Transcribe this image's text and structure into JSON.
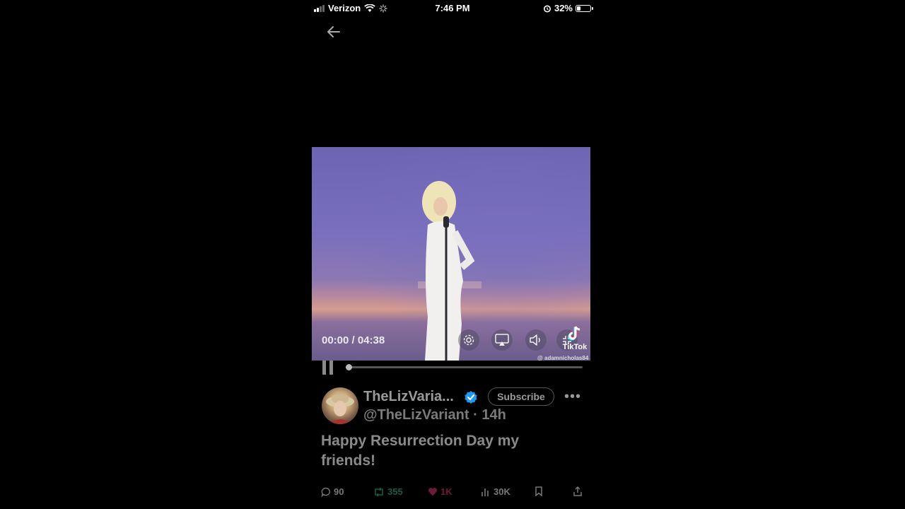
{
  "status_bar": {
    "carrier": "Verizon",
    "time": "7:46 PM",
    "battery": "32%",
    "battery_level": 0.32,
    "signal_bars": 2
  },
  "video": {
    "time_display": "00:00 / 04:38",
    "watermark_brand": "TikTok",
    "watermark_handle": "@ adamnicholas84",
    "progress": 0.0
  },
  "tweet": {
    "display_name": "TheLizVaria...",
    "handle": "@TheLizVariant",
    "separator": "·",
    "age": "14h",
    "subscribe_label": "Subscribe",
    "text": "Happy Resurrection Day my friends!",
    "replies": "90",
    "reposts": "355",
    "likes": "1K",
    "views": "30K"
  },
  "colors": {
    "verified": "#1d9bf0",
    "repost": "#00ba7c",
    "like": "#f91880"
  },
  "icons": {
    "back": "arrow-left-icon",
    "settings": "gear-icon",
    "airplay": "airplay-icon",
    "volume": "volume-icon",
    "fullscreen": "exit-fullscreen-icon",
    "pause": "pause-icon"
  }
}
